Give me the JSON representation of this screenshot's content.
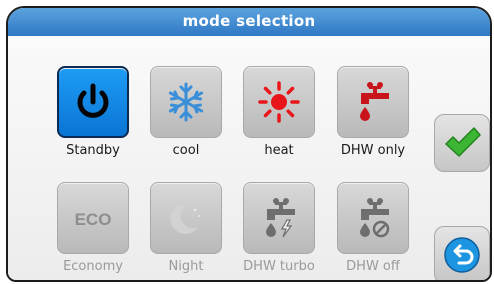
{
  "dialog": {
    "title": "mode selection"
  },
  "modes": [
    {
      "label": "Standby",
      "icon": "power-icon",
      "active": true,
      "enabled": true
    },
    {
      "label": "cool",
      "icon": "snowflake-icon",
      "active": false,
      "enabled": true
    },
    {
      "label": "heat",
      "icon": "sun-icon",
      "active": false,
      "enabled": true
    },
    {
      "label": "DHW only",
      "icon": "faucet-water-drop-icon",
      "active": false,
      "enabled": true
    },
    {
      "label": "Economy",
      "icon": "eco-icon",
      "icon_text": "ECO",
      "active": false,
      "enabled": false
    },
    {
      "label": "Night",
      "icon": "moon-icon",
      "active": false,
      "enabled": false
    },
    {
      "label": "DHW turbo",
      "icon": "faucet-turbo-icon",
      "active": false,
      "enabled": false
    },
    {
      "label": "DHW off",
      "icon": "faucet-off-icon",
      "active": false,
      "enabled": false
    }
  ],
  "actions": {
    "confirm_icon": "checkmark-icon",
    "back_icon": "back-arrow-icon"
  },
  "colors": {
    "title_bar": "#3a86cf",
    "active_tile": "#1292e8",
    "cool": "#3a8fd8",
    "heat": "#e8161b",
    "confirm": "#3cb534",
    "back": "#1d95e0"
  }
}
